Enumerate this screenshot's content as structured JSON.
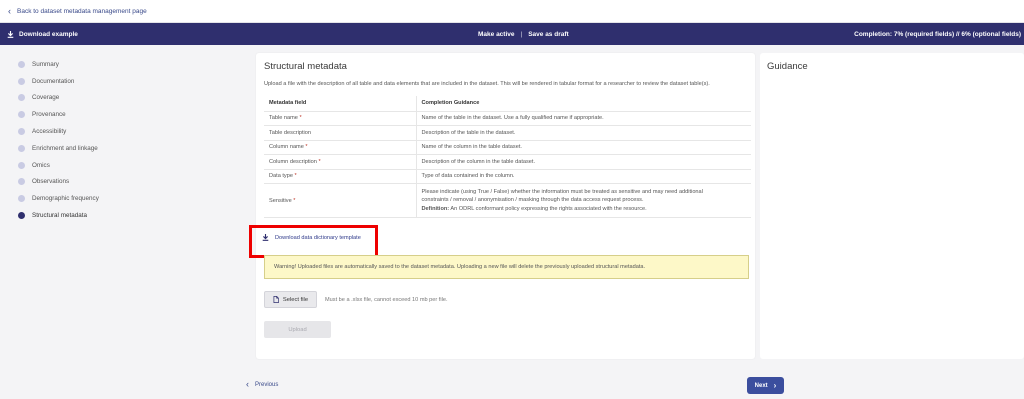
{
  "topbar": {
    "back_label": "Back to dataset metadata management page"
  },
  "actionbar": {
    "download_label": "Download example",
    "make_active": "Make active",
    "separator": "|",
    "save_draft": "Save as draft",
    "completion": "Completion: 7% (required fields) // 6% (optional fields)"
  },
  "sidebar": {
    "items": [
      {
        "label": "Summary"
      },
      {
        "label": "Documentation"
      },
      {
        "label": "Coverage"
      },
      {
        "label": "Provenance"
      },
      {
        "label": "Accessibility"
      },
      {
        "label": "Enrichment and linkage"
      },
      {
        "label": "Omics"
      },
      {
        "label": "Observations"
      },
      {
        "label": "Demographic frequency"
      },
      {
        "label": "Structural metadata"
      }
    ],
    "active_index": 9
  },
  "main": {
    "title": "Structural metadata",
    "description": "Upload a file with the description of all table and data elements that are included in the dataset. This will be rendered in tabular format for a researcher to review the dataset table(s).",
    "table": {
      "headers": [
        "Metadata field",
        "Completion Guidance"
      ],
      "rows": [
        {
          "field": "Table name",
          "required": "*",
          "guidance": "Name of the table in the dataset. Use a fully qualified name if appropriate."
        },
        {
          "field": "Table description",
          "required": "",
          "guidance": "Description of the table in the dataset."
        },
        {
          "field": "Column name",
          "required": "*",
          "guidance": "Name of the column in the table dataset."
        },
        {
          "field": "Column description",
          "required": "*",
          "guidance": "Description of the column in the table dataset."
        },
        {
          "field": "Data type",
          "required": "*",
          "guidance": "Type of data contained in the column."
        },
        {
          "field": "Sensitive",
          "required": "*",
          "guidance_line1": "Please indicate (using True / False) whether the information must be treated as sensitive and may need additional",
          "guidance_line2": "constraints / removal / anonymisation / masking through the data access request process.",
          "definition_label": "Definition:",
          "definition_text": " An ODRL conformant policy expressing the rights associated with the resource."
        }
      ]
    },
    "template_link": "Download data dictionary template",
    "warning": "Warning! Uploaded files are automatically saved to the dataset metadata. Uploading a new file will delete the previously uploaded structural metadata.",
    "select_file": "Select file",
    "file_hint": "Must be a .xlsx file, cannot exceed 10 mb per file.",
    "upload": "Upload"
  },
  "guidance": {
    "title": "Guidance"
  },
  "footer": {
    "previous": "Previous",
    "next": "Next"
  },
  "colors": {
    "brand": "#2f2f6e",
    "next_button": "#3b4e9e",
    "warning_bg": "#fdf8c8",
    "highlight": "#ee0000"
  }
}
